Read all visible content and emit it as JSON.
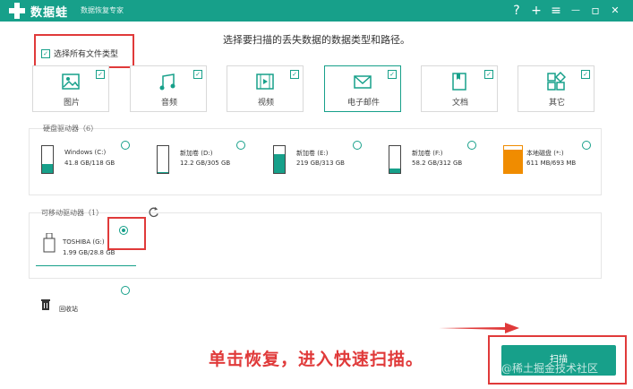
{
  "app": {
    "title": "数据蛙",
    "subtitle": "数据恢复专家"
  },
  "titlebar_buttons": [
    {
      "icon": "help-icon",
      "glyph": "?"
    },
    {
      "icon": "plus-icon",
      "glyph": "+"
    },
    {
      "icon": "menu-icon",
      "glyph": "≡"
    },
    {
      "icon": "minimize-icon",
      "glyph": "—"
    },
    {
      "icon": "restore-icon",
      "glyph": "▫"
    },
    {
      "icon": "close-icon",
      "glyph": "✕"
    }
  ],
  "headline": "选择要扫描的丢失数据的数据类型和路径。",
  "select_all": {
    "label": "选择所有文件类型",
    "checked": true
  },
  "categories": [
    {
      "label": "图片",
      "icon": "image-icon",
      "checked": true
    },
    {
      "label": "音频",
      "icon": "audio-icon",
      "checked": true
    },
    {
      "label": "视频",
      "icon": "video-icon",
      "checked": true
    },
    {
      "label": "电子邮件",
      "icon": "email-icon",
      "checked": true
    },
    {
      "label": "文档",
      "icon": "document-icon",
      "checked": true
    },
    {
      "label": "其它",
      "icon": "other-icon",
      "checked": true
    }
  ],
  "hard_drives": {
    "title": "硬盘驱动器（6）",
    "items": [
      {
        "name": "Windows (C:)",
        "size": "41.8 GB/118 GB",
        "used": 0.35,
        "color": "#17a08a"
      },
      {
        "name": "新加卷 (D:)",
        "size": "12.2 GB/305 GB",
        "used": 0.05,
        "color": "#17a08a"
      },
      {
        "name": "新加卷 (E:)",
        "size": "219 GB/313 GB",
        "used": 0.7,
        "color": "#17a08a"
      },
      {
        "name": "新加卷 (F:)",
        "size": "58.2 GB/312 GB",
        "used": 0.18,
        "color": "#17a08a"
      },
      {
        "name": "本地磁盘 (*:)",
        "size": "611 MB/693 MB",
        "used": 0.88,
        "color": "#f08c00"
      }
    ]
  },
  "removable": {
    "title": "可移动驱动器（1）",
    "refresh_icon": "refresh-icon",
    "items": [
      {
        "name": "TOSHIBA (G:)",
        "size": "1.99 GB/28.8 GB",
        "selected": true
      }
    ]
  },
  "recycle": {
    "label": "回收站",
    "icon": "recycle-bin-icon"
  },
  "hint": "单击恢复，进入快速扫描。",
  "scan_button": "扫描",
  "watermark": "@稀土掘金技术社区",
  "colors": {
    "accent": "#17a08a",
    "highlight": "#e03a3a",
    "orange": "#f08c00"
  }
}
